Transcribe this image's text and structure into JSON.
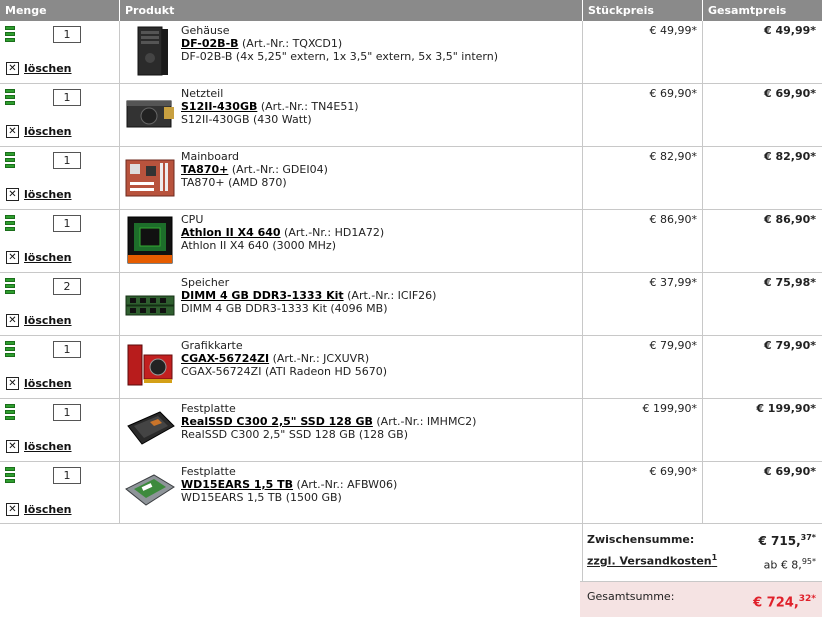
{
  "columns": {
    "qty": "Menge",
    "product": "Produkt",
    "unit_price": "Stückpreis",
    "total_price": "Gesamtpreis"
  },
  "delete_label": "löschen",
  "items": [
    {
      "qty": "1",
      "category": "Gehäuse",
      "name": "DF-02B-B",
      "art": "(Art.-Nr.: TQXCD1)",
      "desc": "DF-02B-B (4x 5,25\" extern, 1x 3,5\" extern, 5x 3,5\" intern)",
      "unit": "€ 49,99*",
      "total": "€ 49,99*",
      "image": "computer-case-image"
    },
    {
      "qty": "1",
      "category": "Netzteil",
      "name": "S12II-430GB",
      "art": "(Art.-Nr.: TN4E51)",
      "desc": "S12II-430GB (430 Watt)",
      "unit": "€ 69,90*",
      "total": "€ 69,90*",
      "image": "power-supply-image"
    },
    {
      "qty": "1",
      "category": "Mainboard",
      "name": "TA870+",
      "art": "(Art.-Nr.: GDEI04)",
      "desc": "TA870+ (AMD 870)",
      "unit": "€ 82,90*",
      "total": "€ 82,90*",
      "image": "mainboard-image"
    },
    {
      "qty": "1",
      "category": "CPU",
      "name": "Athlon II X4 640",
      "art": "(Art.-Nr.: HD1A72)",
      "desc": "Athlon II X4 640 (3000 MHz)",
      "unit": "€ 86,90*",
      "total": "€ 86,90*",
      "image": "cpu-box-image"
    },
    {
      "qty": "2",
      "category": "Speicher",
      "name": "DIMM 4 GB DDR3-1333 Kit",
      "art": "(Art.-Nr.: ICIF26)",
      "desc": "DIMM 4 GB DDR3-1333 Kit (4096 MB)",
      "unit": "€ 37,99*",
      "total": "€ 75,98*",
      "image": "ram-modules-image"
    },
    {
      "qty": "1",
      "category": "Grafikkarte",
      "name": "CGAX-56724ZI",
      "art": "(Art.-Nr.: JCXUVR)",
      "desc": "CGAX-56724ZI (ATI Radeon HD 5670)",
      "unit": "€ 79,90*",
      "total": "€ 79,90*",
      "image": "graphics-card-image"
    },
    {
      "qty": "1",
      "category": "Festplatte",
      "name": "RealSSD C300 2,5\" SSD 128 GB",
      "art": "(Art.-Nr.: IMHMC2)",
      "desc": "RealSSD C300 2,5\" SSD 128 GB (128 GB)",
      "unit": "€ 199,90*",
      "total": "€ 199,90*",
      "image": "ssd-image"
    },
    {
      "qty": "1",
      "category": "Festplatte",
      "name": "WD15EARS 1,5 TB",
      "art": "(Art.-Nr.: AFBW06)",
      "desc": "WD15EARS 1,5 TB (1500 GB)",
      "unit": "€ 69,90*",
      "total": "€ 69,90*",
      "image": "hard-drive-image"
    }
  ],
  "summary": {
    "subtotal_label": "Zwischensumme:",
    "subtotal_main": "€ 715,",
    "subtotal_cents": "37*",
    "shipping_label": "zzgl. Versandkosten",
    "shipping_footnote": "1",
    "shipping_main": "ab € 8,",
    "shipping_cents": "95*",
    "grand_label": "Gesamtsumme:",
    "grand_main": "€ 724,",
    "grand_cents": "32*"
  }
}
